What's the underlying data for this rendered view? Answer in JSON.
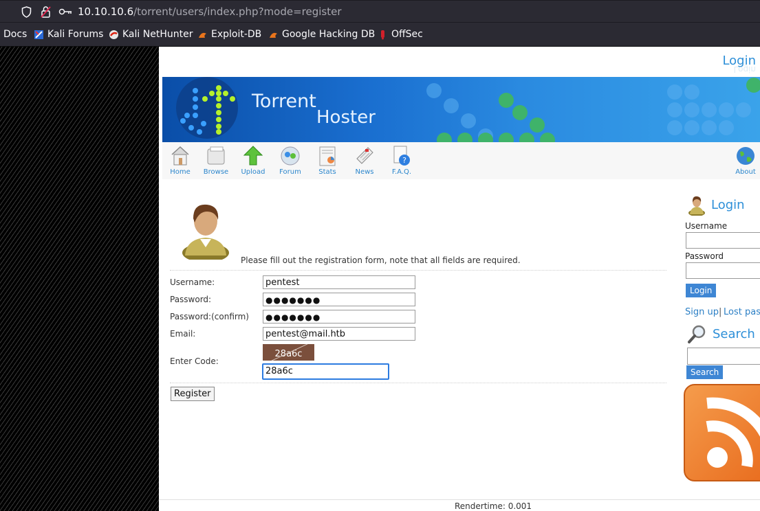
{
  "browser": {
    "url_host": "10.10.10.6",
    "url_path": "/torrent/users/index.php?mode=register",
    "bookmarks": [
      "Docs",
      "Kali Forums",
      "Kali NetHunter",
      "Exploit-DB",
      "Google Hacking DB",
      "OffSec"
    ]
  },
  "header": {
    "login_link": "Login",
    "banner_title_line1": "Torrent",
    "banner_title_line2": "Hoster"
  },
  "nav": {
    "items": [
      "Home",
      "Browse",
      "Upload",
      "Forum",
      "Stats",
      "News",
      "F.A.Q.",
      "About"
    ]
  },
  "register": {
    "intro": "Please fill out the registration form, note that all fields are required.",
    "labels": {
      "username": "Username:",
      "password": "Password:",
      "password_confirm": "Password:(confirm)",
      "email": "Email:",
      "code": "Enter Code:"
    },
    "values": {
      "username": "pentest",
      "password": "●●●●●●●",
      "password_confirm": "●●●●●●●",
      "email": "pentest@mail.htb",
      "captcha": "28a6c",
      "code": "28a6c"
    },
    "submit": "Register"
  },
  "sidebar": {
    "login_title": "Login",
    "username_label": "Username",
    "password_label": "Password",
    "login_button": "Login",
    "signup_link": "Sign up",
    "separator": "|",
    "lost_password_link": "Lost pass",
    "search_title": "Search",
    "search_button": "Search"
  },
  "footer": {
    "rendertime": "Rendertime: 0.001"
  }
}
